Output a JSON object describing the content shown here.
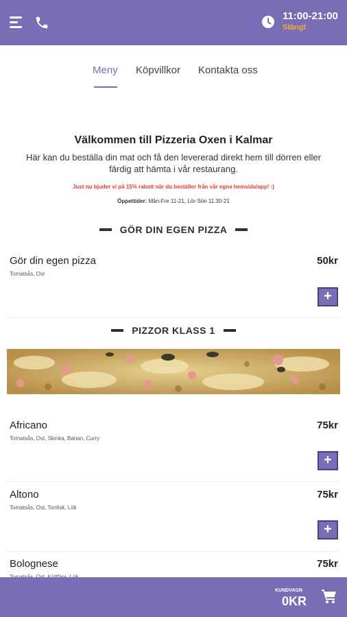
{
  "header": {
    "menu_icon": "hamburger-icon",
    "phone_icon": "phone-icon",
    "clock_icon": "clock-icon",
    "opening_hours": "11:00-21:00",
    "status": "Stängt",
    "status_color": "#f2a93b"
  },
  "theme": {
    "accent": "#7b6db5",
    "promo_color": "#e53935"
  },
  "tabs": [
    {
      "label": "Meny",
      "active": true
    },
    {
      "label": "Köpvillkor",
      "active": false
    },
    {
      "label": "Kontakta oss",
      "active": false
    }
  ],
  "welcome": {
    "title": "Välkommen till Pizzeria Oxen i Kalmar",
    "text": "Här kan du beställa din mat och få den levererad direkt hem till dörren eller färdig att hämta i vår restaurang.",
    "promo": "Just nu bjuder vi på 15% rabatt när du beställer från vår egna hemsida/app! :)",
    "hours_label": "Öppettider:",
    "hours_value": "Mån-Fre 11-21, Lör-Sön 11.30-21"
  },
  "sections": [
    {
      "title": "GÖR DIN EGEN PIZZA",
      "items": [
        {
          "name": "Gör din egen pizza",
          "desc": "Tomatsås, Ost",
          "price": "50kr"
        }
      ]
    },
    {
      "title": "PIZZOR KLASS 1",
      "items": [
        {
          "name": "Africano",
          "desc": "Tomatsås, Ost, Skinka, Banan, Curry",
          "price": "75kr"
        },
        {
          "name": "Altono",
          "desc": "Tomatsås, Ost, Tonfisk, Lök",
          "price": "75kr"
        },
        {
          "name": "Bolognese",
          "desc": "Tomatsås, Ost, Köttfärs, Lök",
          "price": "75kr"
        }
      ]
    }
  ],
  "add_label": "+",
  "cart": {
    "label": "KUNDVAGN",
    "total": "0KR",
    "icon": "cart-icon"
  }
}
